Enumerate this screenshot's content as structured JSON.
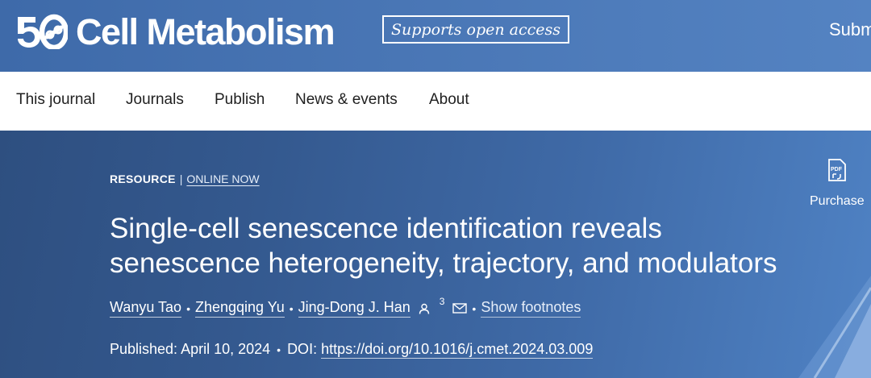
{
  "header": {
    "logo_number": "50",
    "journal_name": "Cell Metabolism",
    "open_access_badge": "Supports open access",
    "submit_label": "Subm",
    "brand_color": "#4a77b6"
  },
  "nav": {
    "items": [
      {
        "label": "This journal"
      },
      {
        "label": "Journals"
      },
      {
        "label": "Publish"
      },
      {
        "label": "News & events"
      },
      {
        "label": "About"
      }
    ]
  },
  "article": {
    "type": "RESOURCE",
    "status": "ONLINE NOW",
    "title_line1": "Single-cell senescence identification reveals",
    "title_line2": "senescence heterogeneity, trajectory, and modulators",
    "authors": [
      {
        "name": "Wanyu Tao"
      },
      {
        "name": "Zhengqing Yu"
      },
      {
        "name": "Jing-Dong J. Han"
      }
    ],
    "corresponding_author_footnote": "3",
    "show_footnotes_label": "Show footnotes",
    "published_label": "Published:",
    "published_date": "April 10, 2024",
    "doi_label": "DOI:",
    "doi_url": "https://doi.org/10.1016/j.cmet.2024.03.009",
    "purchase_label": "Purchase",
    "icons": {
      "pdf": "pdf-icon",
      "person": "person-icon",
      "email": "envelope-icon"
    }
  }
}
